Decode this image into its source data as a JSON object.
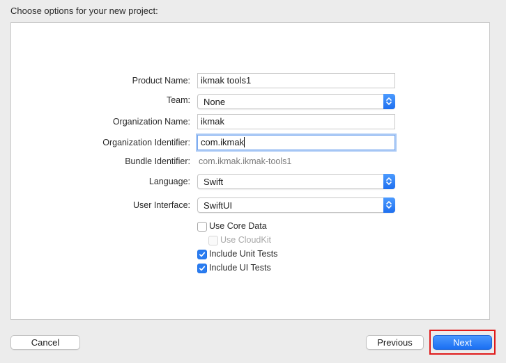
{
  "dialog": {
    "title": "Choose options for your new project:"
  },
  "form": {
    "product_name": {
      "label": "Product Name:",
      "value": "ikmak tools1"
    },
    "team": {
      "label": "Team:",
      "value": "None"
    },
    "organization_name": {
      "label": "Organization Name:",
      "value": "ikmak"
    },
    "organization_identifier": {
      "label": "Organization Identifier:",
      "value": "com.ikmak"
    },
    "bundle_identifier": {
      "label": "Bundle Identifier:",
      "value": "com.ikmak.ikmak-tools1"
    },
    "language": {
      "label": "Language:",
      "value": "Swift"
    },
    "user_interface": {
      "label": "User Interface:",
      "value": "SwiftUI"
    }
  },
  "checkboxes": {
    "use_core_data": {
      "label": "Use Core Data",
      "checked": false,
      "enabled": true
    },
    "use_cloudkit": {
      "label": "Use CloudKit",
      "checked": false,
      "enabled": false
    },
    "include_unit_tests": {
      "label": "Include Unit Tests",
      "checked": true,
      "enabled": true
    },
    "include_ui_tests": {
      "label": "Include UI Tests",
      "checked": true,
      "enabled": true
    }
  },
  "buttons": {
    "cancel": "Cancel",
    "previous": "Previous",
    "next": "Next"
  },
  "colors": {
    "accent": "#2a7cf0",
    "highlight_box": "#e01b1b",
    "window_bg": "#ececec"
  },
  "icons": {
    "popup_stepper": "chevron-up-down-icon",
    "checkbox_check": "checkmark-icon"
  }
}
